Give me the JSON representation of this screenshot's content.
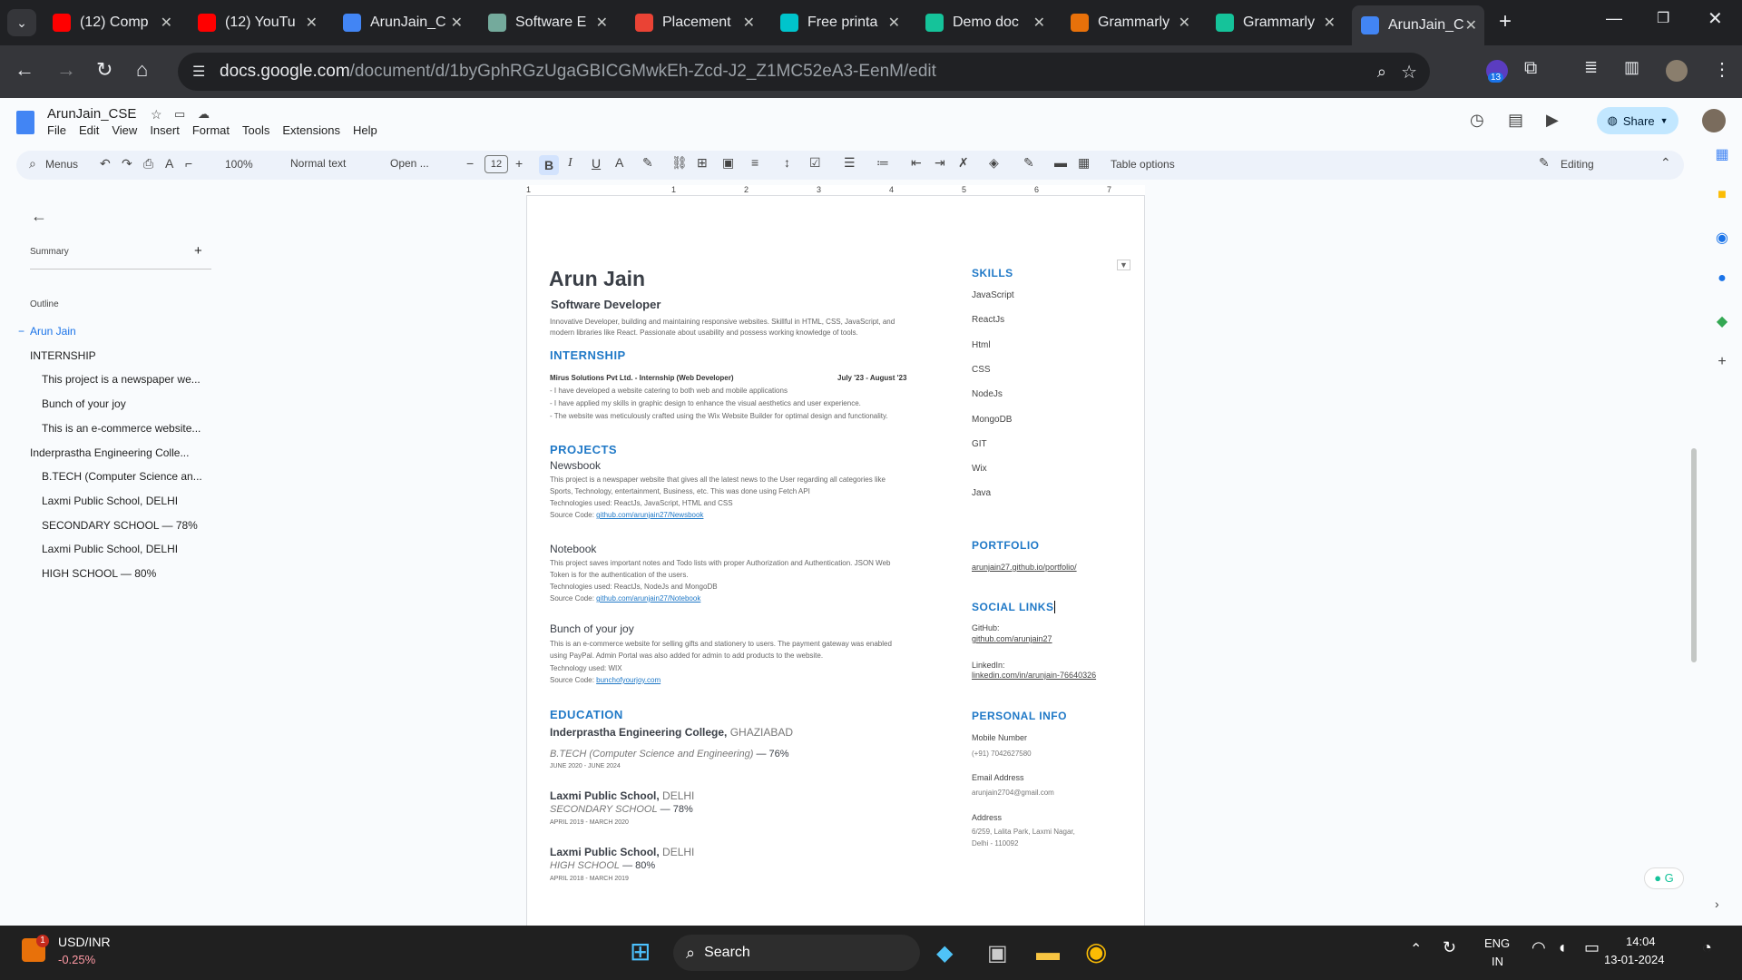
{
  "tabs": [
    {
      "label": "(12) Comp",
      "icon": "youtube-icon",
      "color": "#ff0000"
    },
    {
      "label": "(12) YouTu",
      "icon": "youtube-icon",
      "color": "#ff0000"
    },
    {
      "label": "ArunJain_C",
      "icon": "docs-icon",
      "color": "#4285f4"
    },
    {
      "label": "Software E",
      "icon": "chatgpt-icon",
      "color": "#74aa9c"
    },
    {
      "label": "Placement",
      "icon": "gmail-icon",
      "color": "#ea4335"
    },
    {
      "label": "Free printa",
      "icon": "canva-icon",
      "color": "#00c4cc"
    },
    {
      "label": "Demo doc",
      "icon": "grammarly-icon",
      "color": "#15c39a"
    },
    {
      "label": "Grammarly",
      "icon": "grammarly-image-icon",
      "color": "#e8710a"
    },
    {
      "label": "Grammarly",
      "icon": "grammarly-icon",
      "color": "#15c39a"
    },
    {
      "label": "ArunJain_C",
      "icon": "docs-icon",
      "color": "#4285f4"
    }
  ],
  "url": {
    "host": "docs.google.com",
    "path": "/document/d/1byGphRGzUgaGBICGMwkEh-Zcd-J2_Z1MC52eA3-EenM/edit"
  },
  "ext_badge": "13",
  "doc_title": "ArunJain_CSE",
  "menus": [
    "File",
    "Edit",
    "View",
    "Insert",
    "Format",
    "Tools",
    "Extensions",
    "Help"
  ],
  "share_label": "Share",
  "toolbar": {
    "search": "Menus",
    "zoom": "100%",
    "style": "Normal text",
    "font": "Open ...",
    "size": "12",
    "table": "Table options",
    "mode": "Editing"
  },
  "sidebar": {
    "summary": "Summary",
    "outline": "Outline",
    "items": [
      {
        "label": "Arun Jain",
        "level": 0,
        "active": true
      },
      {
        "label": "INTERNSHIP",
        "level": 0
      },
      {
        "label": "This project is a newspaper we...",
        "level": 1
      },
      {
        "label": "Bunch of your joy",
        "level": 1
      },
      {
        "label": "This is an e-commerce website...",
        "level": 1
      },
      {
        "label": "Inderprastha Engineering Colle...",
        "level": 0
      },
      {
        "label": "B.TECH (Computer Science an...",
        "level": 1
      },
      {
        "label": "Laxmi Public School, DELHI",
        "level": 1
      },
      {
        "label": "SECONDARY SCHOOL — 78%",
        "level": 1
      },
      {
        "label": "Laxmi Public School, DELHI",
        "level": 1
      },
      {
        "label": "HIGH SCHOOL — 80%",
        "level": 1
      }
    ]
  },
  "ruler": [
    "1",
    "1",
    "2",
    "3",
    "4",
    "5",
    "6",
    "7"
  ],
  "resume": {
    "name": "Arun Jain",
    "role": "Software Developer",
    "summary1": "Innovative Developer, building and maintaining responsive websites. Skillful in HTML, CSS, JavaScript, and",
    "summary2": "modern libraries like React. Passionate about usability and possess working knowledge of tools.",
    "internship": "INTERNSHIP",
    "intern_title": "Mirus Solutions Pvt Ltd. - Internship (Web Developer)",
    "intern_date": "July '23 - August '23",
    "intern_b1": "- I have developed a website catering to both web and mobile applications",
    "intern_b2": "- I have applied my skills in graphic design to enhance the visual aesthetics and user experience.",
    "intern_b3": "- The website was meticulously crafted using the Wix Website Builder for optimal design and functionality.",
    "projects": "PROJECTS",
    "p1": {
      "name": "Newsbook",
      "d1": "This project is a newspaper website that gives all the latest news to the User regarding all categories like",
      "d2": "Sports, Technology, entertainment, Business, etc. This was done using Fetch API",
      "tech": "Technologies used: ReactJs, JavaScript, HTML and CSS",
      "src_label": "Source Code: ",
      "src": "github.com/arunjain27/Newsbook"
    },
    "p2": {
      "name": "Notebook",
      "d1": "This project saves important notes and Todo lists with proper Authorization and Authentication. JSON Web",
      "d2": "Token is for the authentication of the users.",
      "tech": "Technologies used: ReactJs, NodeJs and MongoDB",
      "src_label": "Source Code: ",
      "src": "github.com/arunjain27/Notebook"
    },
    "p3": {
      "name": "Bunch of your joy",
      "d1": "This is an e-commerce website for selling gifts and stationery to users. The payment gateway was enabled",
      "d2": "using PayPal. Admin Portal was also added for admin to add products to the website.",
      "tech": "Technology used: WIX",
      "src_label": "Source Code: ",
      "src": "bunchofyourjoy.com"
    },
    "education": "EDUCATION",
    "e1": {
      "school": "Inderprastha Engineering College,",
      "city": "GHAZIABAD",
      "deg": "B.TECH (Computer Science and Engineering)",
      "score": "— 76%",
      "dates": "JUNE 2020 - JUNE 2024"
    },
    "e2": {
      "school": "Laxmi Public School,",
      "city": "DELHI",
      "deg": "SECONDARY SCHOOL",
      "score": "— 78%",
      "dates": "APRIL 2019 - MARCH 2020"
    },
    "e3": {
      "school": "Laxmi Public School,",
      "city": "DELHI",
      "deg": "HIGH SCHOOL",
      "score": "— 80%",
      "dates": "APRIL 2018 - MARCH 2019"
    },
    "skills_h": "SKILLS",
    "skills": [
      "JavaScript",
      "ReactJs",
      "Html",
      "CSS",
      "NodeJs",
      "MongoDB",
      "GIT",
      "Wix",
      "Java"
    ],
    "portfolio_h": "PORTFOLIO",
    "portfolio": "arunjain27.github.io/portfolio/",
    "social_h": "SOCIAL LINKS",
    "github_l": "GitHub:",
    "github": "github.com/arunjain27",
    "linkedin_l": "LinkedIn:",
    "linkedin": "linkedin.com/in/arunjain-76640326",
    "personal_h": "PERSONAL INFO",
    "mobile_l": "Mobile Number",
    "mobile": "(+91) 7042627580",
    "email_l": "Email Address",
    "email": "arunjain2704@gmail.com",
    "address_l": "Address",
    "address1": "6/259, Lalita Park, Laxmi Nagar,",
    "address2": "Delhi - 110092"
  },
  "taskbar": {
    "stock": "USD/INR",
    "change": "-0.25%",
    "badge": "1",
    "search": "Search",
    "lang1": "ENG",
    "lang2": "IN",
    "time": "14:04",
    "date": "13-01-2024"
  }
}
